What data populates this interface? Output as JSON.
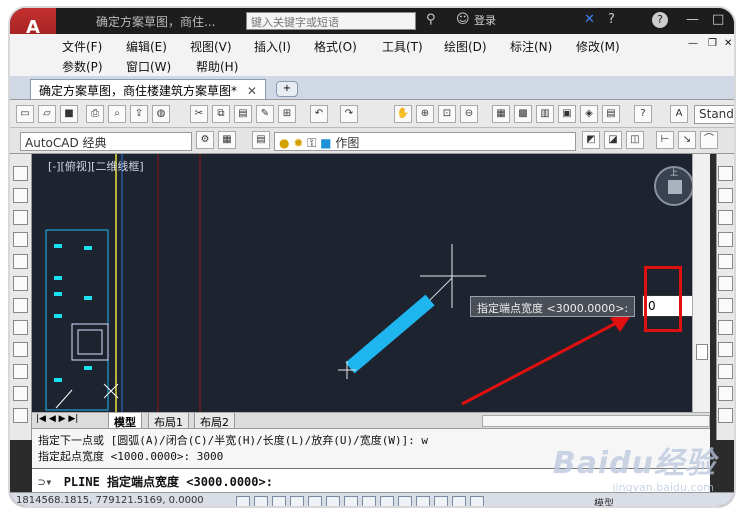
{
  "window": {
    "title": "确定方案草图，商住...",
    "search_placeholder": "键入关键字或短语",
    "login": "登录"
  },
  "menu": {
    "row1": [
      "文件(F)",
      "编辑(E)",
      "视图(V)",
      "插入(I)",
      "格式(O)",
      "工具(T)",
      "绘图(D)",
      "标注(N)",
      "修改(M)"
    ],
    "row2": [
      "参数(P)",
      "窗口(W)",
      "帮助(H)"
    ]
  },
  "doc_tab": {
    "label": "确定方案草图，商住楼建筑方案草图*"
  },
  "toolbar2": {
    "workspace": "AutoCAD 经典",
    "layer": "作图",
    "style": "Stand"
  },
  "canvas": {
    "view_label": "[-][俯视][二维线框]",
    "navcube_label": "上"
  },
  "layout_tabs": [
    "模型",
    "布局1",
    "布局2"
  ],
  "dynamic_prompt": {
    "label": "指定端点宽度 <3000.0000>:",
    "value": "0"
  },
  "command_history": [
    "指定下一点或 [圆弧(A)/闭合(C)/半宽(H)/长度(L)/放弃(U)/宽度(W)]: w",
    "指定起点宽度 <1000.0000>: 3000"
  ],
  "command_line": {
    "text": "PLINE 指定端点宽度 <3000.0000>:"
  },
  "status": {
    "coords": "1814568.1815, 779121.5169, 0.0000",
    "model_label": "模型"
  },
  "watermark": {
    "brand": "Baidu经验",
    "url": "jingyan.baidu.com"
  },
  "colors": {
    "canvas_bg": "#1e2330",
    "polyline": "#1fb6f0",
    "annotation_red": "#e01010"
  }
}
